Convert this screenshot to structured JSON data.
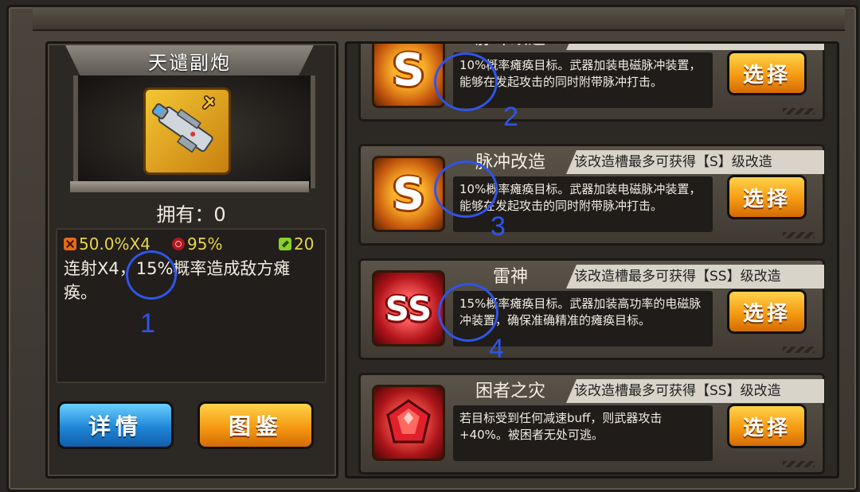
{
  "left_panel": {
    "weapon_name": "天谴副炮",
    "owned_label": "拥有：0",
    "stats": {
      "burst": "50.0%X4",
      "accuracy": "95%",
      "ammo": "20"
    },
    "description": "连射X4，15%概率造成敌方瘫痪。",
    "buttons": {
      "details": "详情",
      "codex": "图鉴"
    }
  },
  "mod_list": [
    {
      "name": "脉冲改造",
      "limit": "该改造槽最多可获得【S】级改造",
      "grade": "S",
      "description": "10%概率瘫痪目标。武器加装电磁脉冲装置，能够在发起攻击的同时附带脉冲打击。",
      "select_label": "选择"
    },
    {
      "name": "脉冲改造",
      "limit": "该改造槽最多可获得【S】级改造",
      "grade": "S",
      "description": "10%概率瘫痪目标。武器加装电磁脉冲装置，能够在发起攻击的同时附带脉冲打击。",
      "select_label": "选择"
    },
    {
      "name": "雷神",
      "limit": "该改造槽最多可获得【SS】级改造",
      "grade": "SS",
      "description": "15%概率瘫痪目标。武器加装高功率的电磁脉冲装置，确保准确精准的瘫痪目标。",
      "select_label": "选择"
    },
    {
      "name": "困者之灾",
      "limit": "该改造槽最多可获得【SS】级改造",
      "grade": "",
      "description": "若目标受到任何减速buff，则武器攻击+40%。被困者无处可逃。",
      "select_label": "选择"
    }
  ],
  "annotations": [
    "1",
    "2",
    "3",
    "4"
  ],
  "colors": {
    "annotation": "#2f55e8",
    "button_orange": "#f59a12",
    "button_blue": "#1f86d8",
    "stat_text": "#e8d44a"
  }
}
